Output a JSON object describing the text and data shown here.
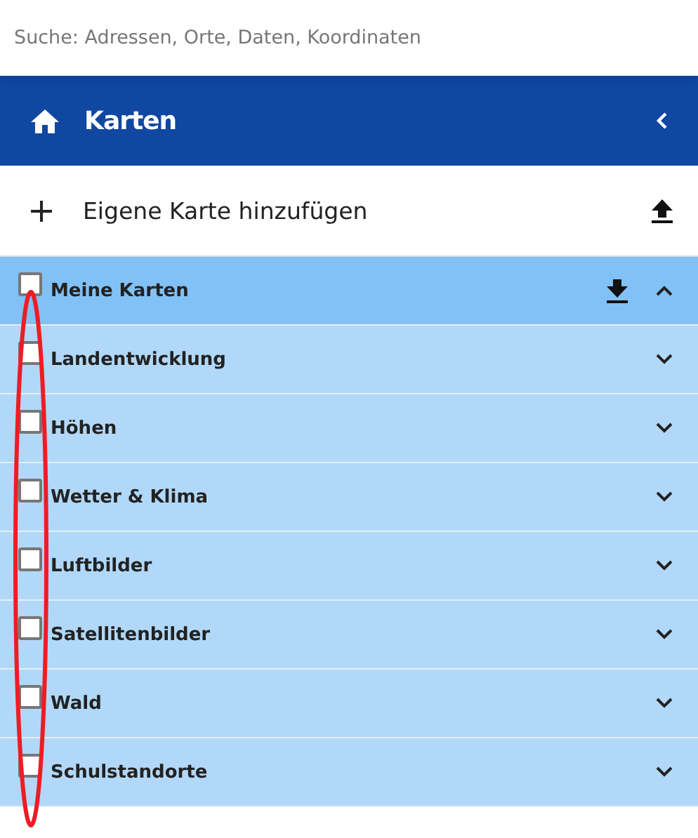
{
  "search": {
    "placeholder": "Suche: Adressen, Orte, Daten, Koordinaten"
  },
  "header": {
    "title": "Karten"
  },
  "add_map": {
    "label": "Eigene Karte hinzufügen"
  },
  "layers": [
    {
      "kind": "own",
      "label": "Meine Karten",
      "checked": false,
      "expanded": true
    },
    {
      "kind": "category",
      "label": "Landentwicklung",
      "checked": false,
      "expanded": false
    },
    {
      "kind": "category",
      "label": "Höhen",
      "checked": false,
      "expanded": false
    },
    {
      "kind": "category",
      "label": "Wetter & Klima",
      "checked": false,
      "expanded": false
    },
    {
      "kind": "category",
      "label": "Luftbilder",
      "checked": false,
      "expanded": false
    },
    {
      "kind": "category",
      "label": "Satellitenbilder",
      "checked": false,
      "expanded": false
    },
    {
      "kind": "category",
      "label": "Wald",
      "checked": false,
      "expanded": false
    },
    {
      "kind": "category",
      "label": "Schulstandorte",
      "checked": false,
      "expanded": false
    }
  ],
  "annotation": {
    "kind": "ellipse",
    "color": "#ee1c25"
  }
}
